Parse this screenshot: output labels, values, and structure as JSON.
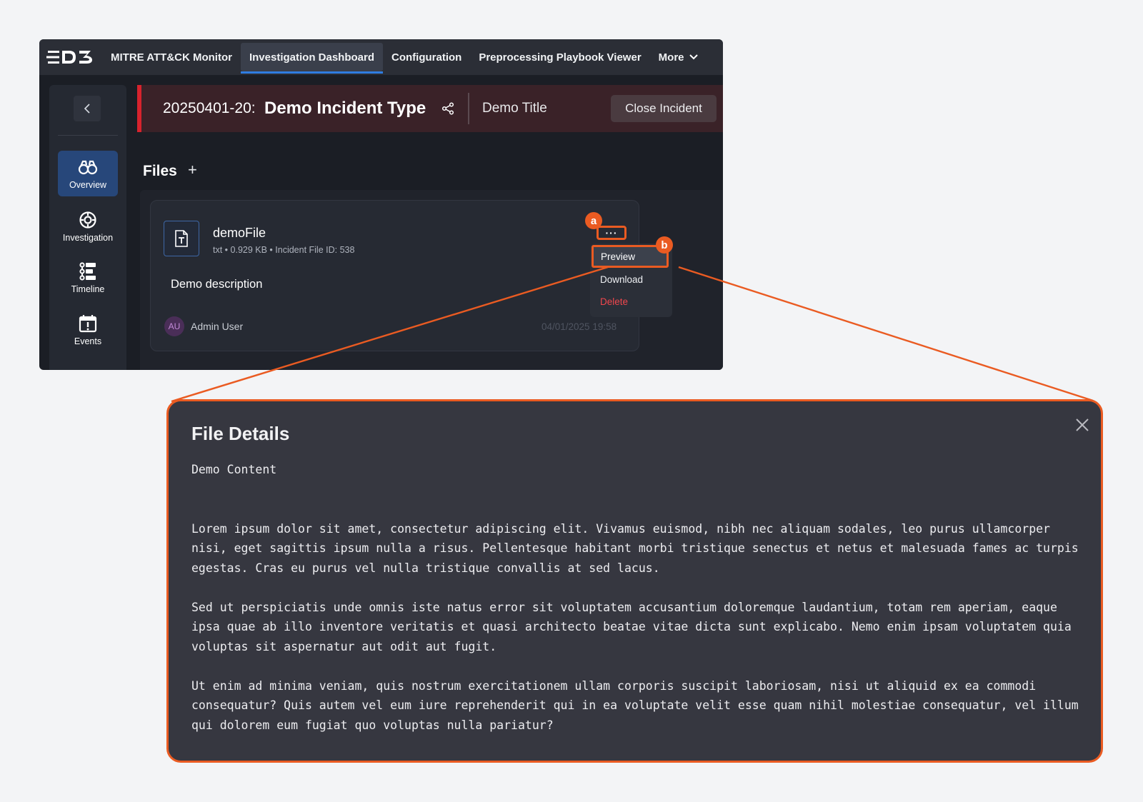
{
  "nav": {
    "logo_text": "D3",
    "tabs": [
      {
        "label": "MITRE ATT&CK Monitor"
      },
      {
        "label": "Investigation Dashboard",
        "active": true
      },
      {
        "label": "Configuration"
      },
      {
        "label": "Preprocessing Playbook Viewer"
      },
      {
        "label": "More"
      }
    ]
  },
  "sidebar": {
    "items": [
      {
        "label": "Overview",
        "icon": "binoculars-icon",
        "active": true
      },
      {
        "label": "Investigation",
        "icon": "target-icon"
      },
      {
        "label": "Timeline",
        "icon": "timeline-icon"
      },
      {
        "label": "Events",
        "icon": "calendar-icon"
      }
    ]
  },
  "incident": {
    "id": "20250401-20:",
    "type": "Demo Incident Type",
    "title": "Demo Title",
    "close_label": "Close Incident"
  },
  "files": {
    "heading": "Files",
    "add_label": "+",
    "file": {
      "name": "demoFile",
      "meta": "txt • 0.929 KB • Incident File ID: 538",
      "description": "Demo description",
      "user_initials": "AU",
      "user_name": "Admin User",
      "date": "04/01/2025 19:58",
      "more_label": "···"
    },
    "menu": {
      "preview": "Preview",
      "download": "Download",
      "delete": "Delete"
    }
  },
  "badges": {
    "a": "a",
    "b": "b"
  },
  "modal": {
    "title": "File Details",
    "content_heading": "Demo Content",
    "paragraphs": [
      "Lorem ipsum dolor sit amet, consectetur adipiscing elit. Vivamus euismod, nibh nec aliquam sodales, leo purus ullamcorper nisi, eget sagittis ipsum nulla a risus. Pellentesque habitant morbi tristique senectus et netus et malesuada fames ac turpis egestas. Cras eu purus vel nulla tristique convallis at sed lacus.",
      "Sed ut perspiciatis unde omnis iste natus error sit voluptatem accusantium doloremque laudantium, totam rem aperiam, eaque ipsa quae ab illo inventore veritatis et quasi architecto beatae vitae dicta sunt explicabo. Nemo enim ipsam voluptatem quia voluptas sit aspernatur aut odit aut fugit.",
      "Ut enim ad minima veniam, quis nostrum exercitationem ullam corporis suscipit laboriosam, nisi ut aliquid ex ea commodi consequatur? Quis autem vel eum iure reprehenderit qui in ea voluptate velit esse quam nihil molestiae consequatur, vel illum qui dolorem eum fugiat quo voluptas nulla pariatur?"
    ]
  },
  "colors": {
    "accent": "#ea5b22",
    "incident_red": "#d7232d",
    "active_blue": "#27477a",
    "delete_red": "#f0474d"
  }
}
